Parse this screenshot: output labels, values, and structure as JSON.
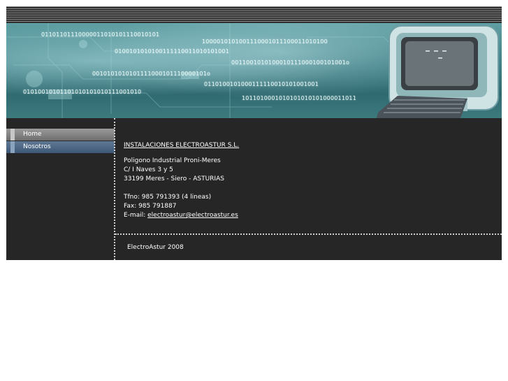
{
  "banner": {
    "binary_lines": [
      "01101101110000011010101110010101",
      "1000010101001110001011100011010100",
      "0100101010100111110011010101001",
      "0011001010100010111000100101001o",
      "0010101010101111000101110000101o",
      "0110100101000111110010101001001",
      "01010010101101010101010111001010",
      "1011010001010101010101000011011"
    ],
    "computer_image": "computer-monitor-keyboard-icon"
  },
  "nav": {
    "items": [
      {
        "label": "Home"
      },
      {
        "label": "Nosotros"
      }
    ]
  },
  "content": {
    "company": "INSTALACIONES ELECTROASTUR S.L.",
    "address_line1": "Poligono Industrial Proni-Meres",
    "address_line2": "C/ I Naves 3 y 5",
    "address_line3": "33199 Meres - Siero - ASTURIAS",
    "phone": "Tfno: 985 791393 (4 lineas)",
    "fax": "Fax: 985 791887",
    "email_label": "E-mail: ",
    "email": "electroastur@electroastur.es"
  },
  "footer": {
    "text": "ElectroAstur 2008"
  }
}
